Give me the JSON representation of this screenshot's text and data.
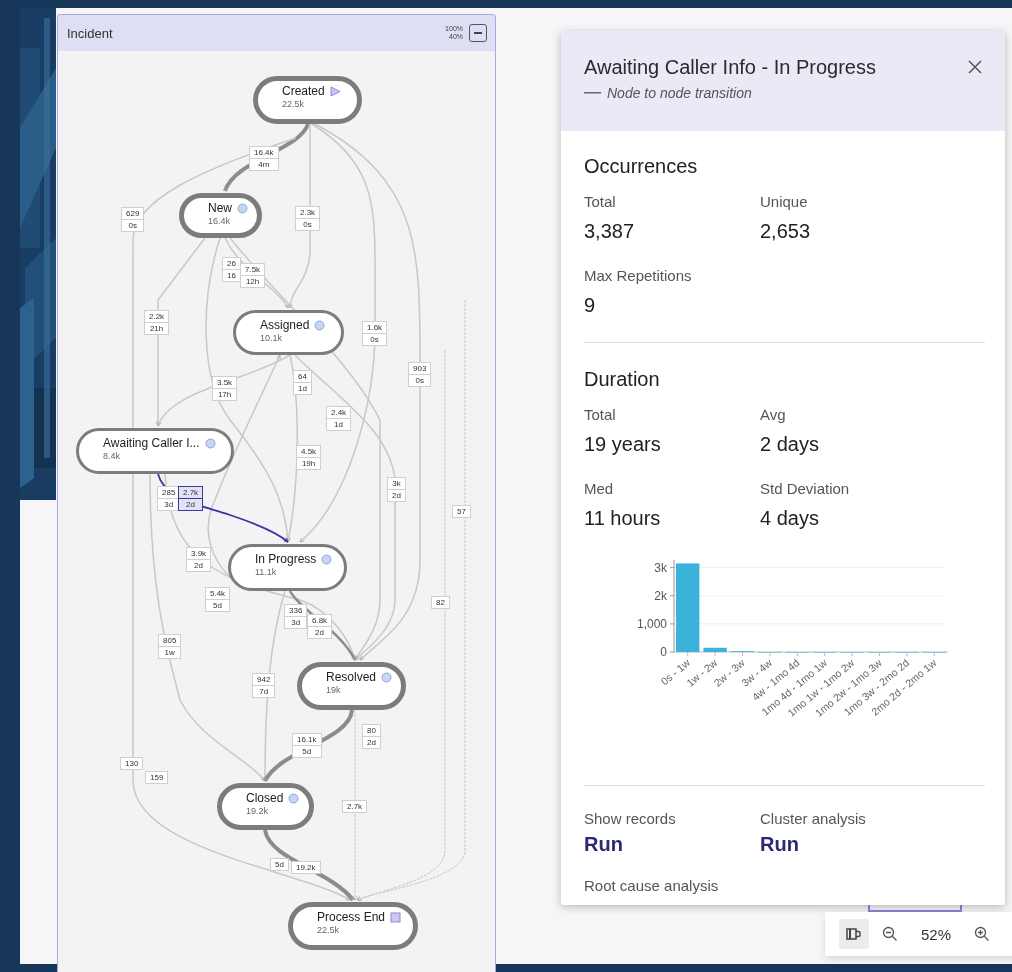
{
  "diagram": {
    "title": "Incident",
    "scale_labels": [
      "100%",
      "40%"
    ],
    "nodes": [
      {
        "name": "Created",
        "count": "22.5k",
        "kind": "start"
      },
      {
        "name": "New",
        "count": "16.4k",
        "kind": "activity"
      },
      {
        "name": "Assigned",
        "count": "10.1k",
        "kind": "activity"
      },
      {
        "name": "Awaiting Caller I...",
        "count": "8.4k",
        "kind": "activity"
      },
      {
        "name": "In Progress",
        "count": "11.1k",
        "kind": "activity"
      },
      {
        "name": "Resolved",
        "count": "19k",
        "kind": "activity"
      },
      {
        "name": "Closed",
        "count": "19.2k",
        "kind": "activity"
      },
      {
        "name": "Process End",
        "count": "22.5k",
        "kind": "end"
      }
    ],
    "edge_labels": [
      {
        "lines": [
          "16.4k",
          "4m"
        ],
        "selected": false
      },
      {
        "lines": [
          "629",
          "0s"
        ],
        "selected": false
      },
      {
        "lines": [
          "2.3k",
          "0s"
        ],
        "selected": false
      },
      {
        "lines": [
          "26",
          "16"
        ],
        "selected": false
      },
      {
        "lines": [
          "7.5k",
          "12h"
        ],
        "selected": false
      },
      {
        "lines": [
          "2.2k",
          "21h"
        ],
        "selected": false
      },
      {
        "lines": [
          "1.6k",
          "0s"
        ],
        "selected": false
      },
      {
        "lines": [
          "903",
          "0s"
        ],
        "selected": false
      },
      {
        "lines": [
          "3.5k",
          "17h"
        ],
        "selected": false
      },
      {
        "lines": [
          "64",
          "1d"
        ],
        "selected": false
      },
      {
        "lines": [
          "2.4k",
          "1d"
        ],
        "selected": false
      },
      {
        "lines": [
          "4.5k",
          "19h"
        ],
        "selected": false
      },
      {
        "lines": [
          "3k",
          "2d"
        ],
        "selected": false
      },
      {
        "lines": [
          "57"
        ],
        "selected": false
      },
      {
        "lines": [
          "285",
          "3d"
        ],
        "selected": false
      },
      {
        "lines": [
          "2.7k",
          "2d"
        ],
        "selected": true
      },
      {
        "lines": [
          "3.9k",
          "2d"
        ],
        "selected": false
      },
      {
        "lines": [
          "5.4k",
          "5d"
        ],
        "selected": false
      },
      {
        "lines": [
          "82"
        ],
        "selected": false
      },
      {
        "lines": [
          "336",
          "3d"
        ],
        "selected": false
      },
      {
        "lines": [
          "6.8k",
          "2d"
        ],
        "selected": false
      },
      {
        "lines": [
          "805",
          "1w"
        ],
        "selected": false
      },
      {
        "lines": [
          "942",
          "7d"
        ],
        "selected": false
      },
      {
        "lines": [
          "80",
          "2d"
        ],
        "selected": false
      },
      {
        "lines": [
          "16.1k",
          "5d"
        ],
        "selected": false
      },
      {
        "lines": [
          "130"
        ],
        "selected": false
      },
      {
        "lines": [
          "159"
        ],
        "selected": false
      },
      {
        "lines": [
          "2.7k"
        ],
        "selected": false
      },
      {
        "lines": [
          "5d"
        ],
        "selected": false
      },
      {
        "lines": [
          "19.2k"
        ],
        "selected": false
      }
    ]
  },
  "details": {
    "title": "Awaiting Caller Info - In Progress",
    "subtitle": "Node to node transition",
    "sections": [
      {
        "heading": "Occurrences",
        "stats": [
          {
            "label": "Total",
            "value": "3,387"
          },
          {
            "label": "Unique",
            "value": "2,653"
          },
          {
            "label": "Max Repetitions",
            "value": "9"
          }
        ]
      },
      {
        "heading": "Duration",
        "stats": [
          {
            "label": "Total",
            "value": "19 years"
          },
          {
            "label": "Avg",
            "value": "2 days"
          },
          {
            "label": "Med",
            "value": "11 hours"
          },
          {
            "label": "Std Deviation",
            "value": "4 days"
          }
        ],
        "chart_data": {
          "type": "bar",
          "categories": [
            "0s - 1w",
            "1w - 2w",
            "2w - 3w",
            "3w - 4w",
            "4w - 1mo 4d",
            "1mo 4d - 1mo 1w",
            "1mo 1w - 1mo 2w",
            "1mo 2w - 1mo 3w",
            "1mo 3w - 2mo 2d",
            "2mo 2d - 2mo 1w"
          ],
          "values": [
            3150,
            150,
            30,
            0,
            0,
            0,
            0,
            0,
            0,
            0
          ],
          "ylim": [
            0,
            3200
          ],
          "grid": true,
          "yticks": [
            0,
            {
              "value": 1000,
              "label": "1,000"
            },
            {
              "value": 2000,
              "label": "2k"
            },
            {
              "value": 3000,
              "label": "3k"
            }
          ]
        }
      }
    ],
    "actions": [
      {
        "label": "Show records",
        "link": "Run"
      },
      {
        "label": "Cluster analysis",
        "link": "Run"
      }
    ],
    "more": "Root cause analysis"
  },
  "zoom": {
    "level_text": "52%"
  }
}
